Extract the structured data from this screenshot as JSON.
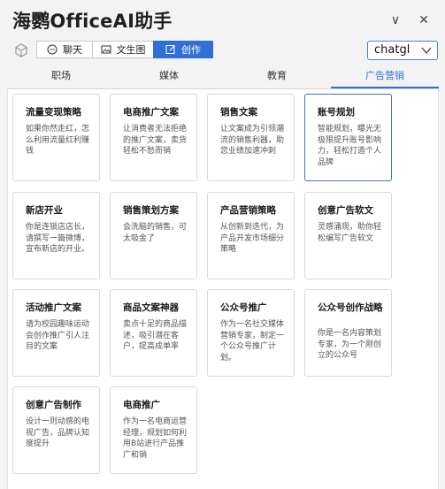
{
  "app": {
    "title": "海鹦OfficeAI助手",
    "collapse_glyph": "∨",
    "close_glyph": "✕"
  },
  "toolbar": {
    "modes": [
      {
        "label": "聊天",
        "icon": "chat-bubble-icon"
      },
      {
        "label": "文生图",
        "icon": "image-icon"
      },
      {
        "label": "创作",
        "icon": "edit-icon",
        "active": true
      }
    ],
    "model": {
      "selected": "chatgl"
    }
  },
  "tabs": [
    {
      "label": "职场"
    },
    {
      "label": "媒体"
    },
    {
      "label": "教育"
    },
    {
      "label": "广告营销",
      "active": true
    }
  ],
  "cards": [
    {
      "title": "流量变现策略",
      "desc": "如果你然走红，怎么利用流量红利赚钱"
    },
    {
      "title": "电商推广文案",
      "desc": "让消费者无法拒绝的推广文案，卖货轻松不愁而销"
    },
    {
      "title": "销售文案",
      "desc": "让文案成为引领潮流的销售利器，助您业绩加速冲刺"
    },
    {
      "title": "账号规划",
      "desc": "智能规划，曝光无极限提升账号影响力，轻松打造个人品牌",
      "selected": true
    },
    {
      "title": "新店开业",
      "desc": "你是连锁店店长，请撰写一篇微博，宣布新店的开业。"
    },
    {
      "title": "销售策划方案",
      "desc": "会洗脑的销售，可太吸金了"
    },
    {
      "title": "产品营销策略",
      "desc": "从创新到迭代，为产品开发市场细分策略"
    },
    {
      "title": "创意广告软文",
      "desc": "灵感涌现，助你轻松编写广告软文"
    },
    {
      "title": "活动推广文案",
      "desc": "请为校园趣味运动会创作推广引人注目的文案"
    },
    {
      "title": "商品文案神器",
      "desc": "卖点十足的商品描述，吸引潜在客户，提高成单率"
    },
    {
      "title": "公众号推广",
      "desc": "作为一名社交媒体营销专家，制定一个公众号推广计划。"
    },
    {
      "title": "公众号创作战略",
      "desc": "你是一名内容策划专家，为一个刚创立的公众号"
    },
    {
      "title": "创意广告制作",
      "desc": "设计一则动感的电视广告，品牌认知度提升"
    },
    {
      "title": "电商推广",
      "desc": "作为一名电商运营经理，规划如何利用B站进行产品推广和销"
    }
  ]
}
